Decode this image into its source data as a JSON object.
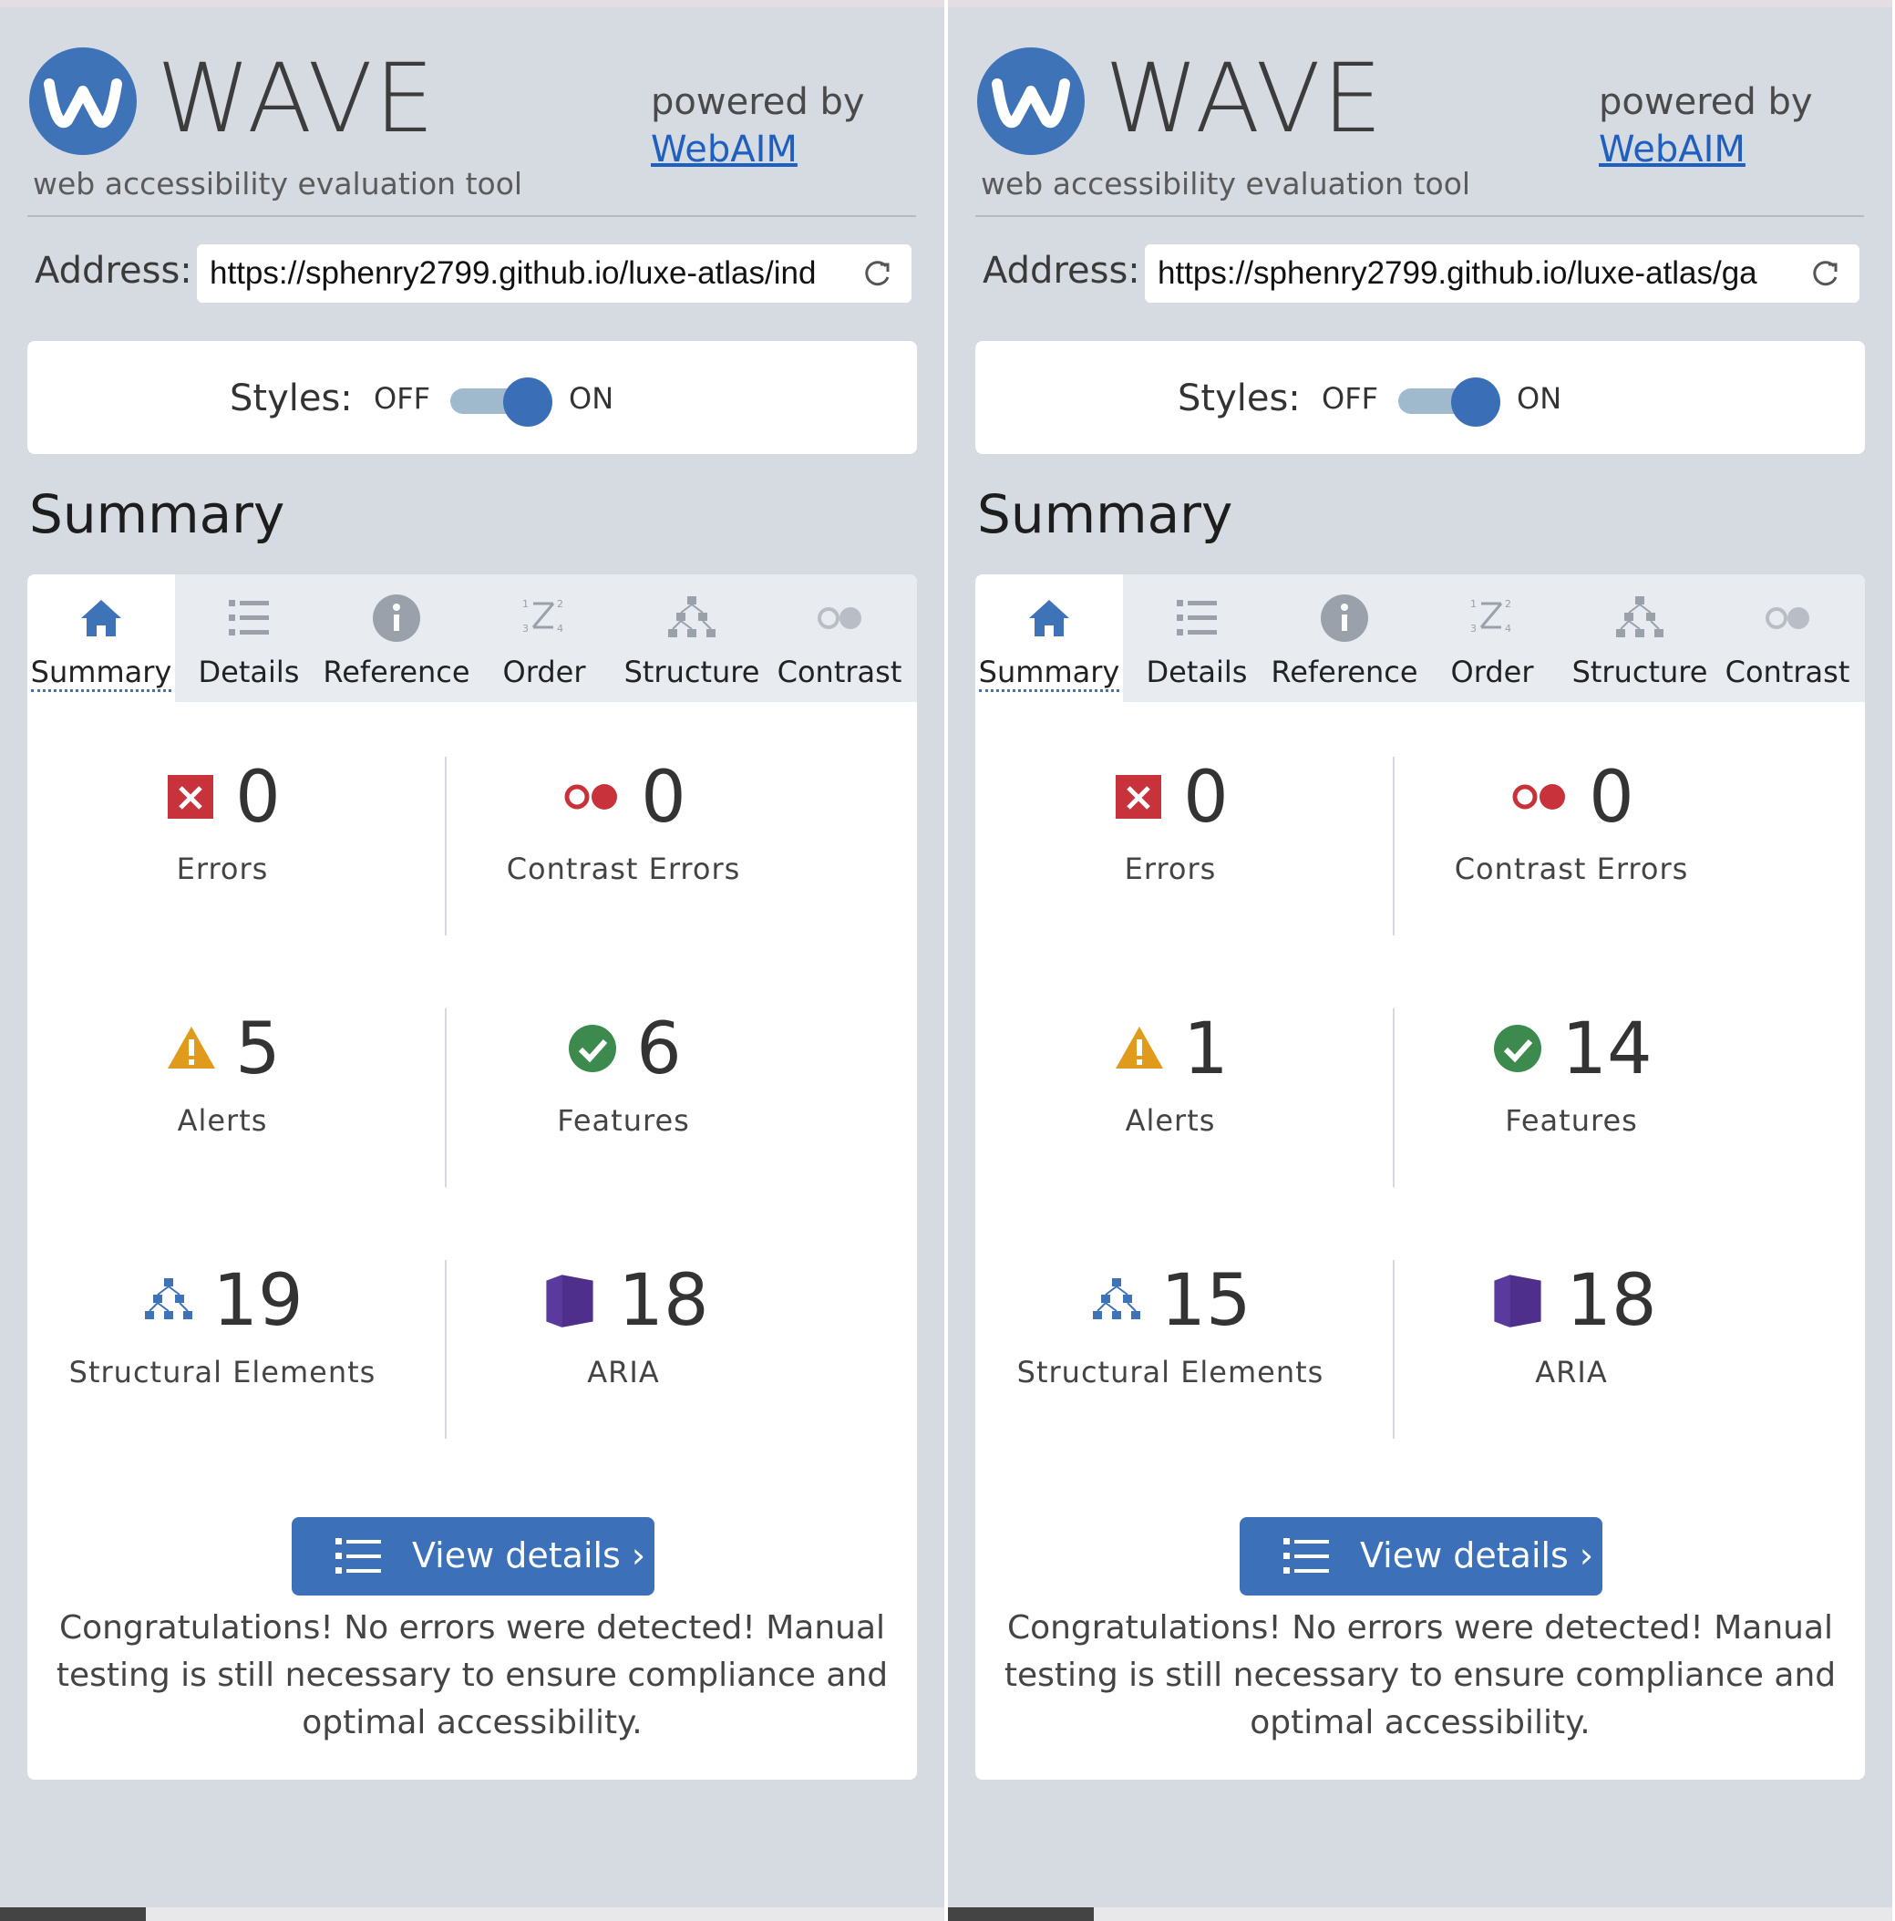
{
  "panels": [
    {
      "logo": {
        "word": "WAVE",
        "tagline": "web accessibility evaluation tool"
      },
      "powered_by": "powered by",
      "webaim_link": "WebAIM",
      "address_label": "Address:",
      "address_value": "https://sphenry2799.github.io/luxe-atlas/ind",
      "styles_label": "Styles:",
      "styles_off": "OFF",
      "styles_on": "ON",
      "summary_heading": "Summary",
      "tabs": [
        "Summary",
        "Details",
        "Reference",
        "Order",
        "Structure",
        "Contrast"
      ],
      "stats": {
        "errors": {
          "count": "0",
          "label": "Errors"
        },
        "contrast_errors": {
          "count": "0",
          "label": "Contrast Errors"
        },
        "alerts": {
          "count": "5",
          "label": "Alerts"
        },
        "features": {
          "count": "6",
          "label": "Features"
        },
        "structural": {
          "count": "19",
          "label": "Structural Elements"
        },
        "aria": {
          "count": "18",
          "label": "ARIA"
        }
      },
      "view_details": "View details ›",
      "congrats": "Congratulations! No errors were detected! Manual testing is still necessary to ensure compliance and optimal accessibility."
    },
    {
      "logo": {
        "word": "WAVE",
        "tagline": "web accessibility evaluation tool"
      },
      "powered_by": "powered by",
      "webaim_link": "WebAIM",
      "address_label": "Address:",
      "address_value": "https://sphenry2799.github.io/luxe-atlas/ga",
      "styles_label": "Styles:",
      "styles_off": "OFF",
      "styles_on": "ON",
      "summary_heading": "Summary",
      "tabs": [
        "Summary",
        "Details",
        "Reference",
        "Order",
        "Structure",
        "Contrast"
      ],
      "stats": {
        "errors": {
          "count": "0",
          "label": "Errors"
        },
        "contrast_errors": {
          "count": "0",
          "label": "Contrast Errors"
        },
        "alerts": {
          "count": "1",
          "label": "Alerts"
        },
        "features": {
          "count": "14",
          "label": "Features"
        },
        "structural": {
          "count": "15",
          "label": "Structural Elements"
        },
        "aria": {
          "count": "18",
          "label": "ARIA"
        }
      },
      "view_details": "View details ›",
      "congrats": "Congratulations! No errors were detected! Manual testing is still necessary to ensure compliance and optimal accessibility."
    }
  ],
  "colors": {
    "background": "#d6dae1",
    "brand_blue": "#3e73b8",
    "error_red": "#c8323a",
    "alert_orange": "#e19b1c",
    "feature_green": "#3d8a4e",
    "aria_purple": "#4e2f8c"
  },
  "icons": {
    "logo": "wave-logo-icon",
    "reload": "reload-icon",
    "tabs": [
      "home-icon",
      "list-icon",
      "info-icon",
      "order-icon",
      "structure-icon",
      "contrast-icon"
    ],
    "stats": [
      "error-icon",
      "contrast-error-icon",
      "alert-icon",
      "feature-icon",
      "structure-icon",
      "aria-icon"
    ],
    "view_details": "list-icon"
  }
}
